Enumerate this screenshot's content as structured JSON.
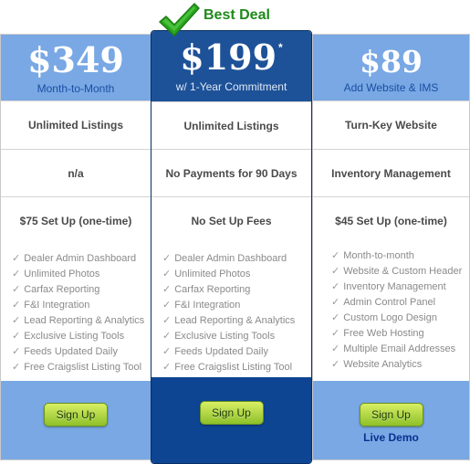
{
  "badge": {
    "label": "Best Deal",
    "icon": "checkmark-icon",
    "color": "#2aa51f"
  },
  "plans": [
    {
      "price": "$349",
      "subtitle": "Month-to-Month",
      "features": [
        "Unlimited Listings",
        "n/a",
        "$75 Set Up (one-time)"
      ],
      "items": [
        "Dealer Admin Dashboard",
        "Unlimited Photos",
        "Carfax Reporting",
        "F&I Integration",
        "Lead Reporting & Analytics",
        "Exclusive Listing Tools",
        "Feeds Updated Daily",
        "Free Craigslist Listing Tool"
      ],
      "button": "Sign Up"
    },
    {
      "price": "$199",
      "asterisk": "*",
      "subtitle": "w/ 1-Year Commitment",
      "features": [
        "Unlimited Listings",
        "No Payments for 90 Days",
        "No Set Up Fees"
      ],
      "items": [
        "Dealer Admin Dashboard",
        "Unlimited Photos",
        "Carfax Reporting",
        "F&I Integration",
        "Lead Reporting & Analytics",
        "Exclusive Listing Tools",
        "Feeds Updated Daily",
        "Free Craigslist Listing Tool"
      ],
      "button": "Sign Up"
    },
    {
      "price": "$89",
      "subtitle": "Add Website & IMS",
      "features": [
        "Turn-Key Website",
        "Inventory Management",
        "$45 Set Up (one-time)"
      ],
      "items": [
        "Month-to-month",
        "Website & Custom Header",
        "Inventory Management",
        "Admin Control Panel",
        "Custom Logo Design",
        "Free Web Hosting",
        "Multiple Email Addresses",
        "Website Analytics"
      ],
      "button": "Sign Up",
      "link": "Live Demo"
    }
  ],
  "check_glyph": "✓",
  "colors": {
    "side_header": "#79a8e4",
    "featured_header": "#1e5298",
    "featured_footer": "#0d4593",
    "button_top": "#d8ef64",
    "button_bottom": "#8ec02a",
    "demo_link": "#0b2f8f"
  }
}
